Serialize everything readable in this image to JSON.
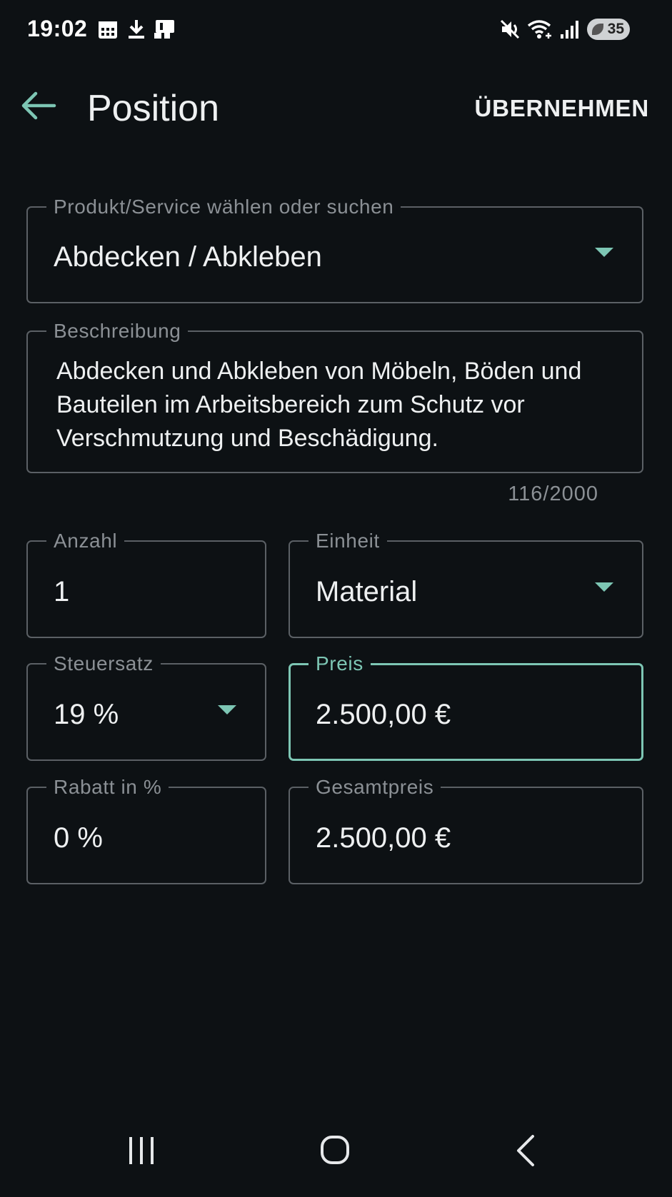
{
  "status_bar": {
    "time": "19:02",
    "battery_level": "35",
    "icons": [
      "calendar-icon",
      "download-icon",
      "clipboard-icon",
      "mute-icon",
      "wifi-icon",
      "signal-icon",
      "battery-icon"
    ]
  },
  "app_bar": {
    "title": "Position",
    "action_label": "ÜBERNEHMEN",
    "back_icon": "arrow-left-icon"
  },
  "form": {
    "product": {
      "label": "Produkt/Service wählen oder suchen",
      "value": "Abdecken / Abkleben"
    },
    "description": {
      "label": "Beschreibung",
      "value": "Abdecken und Abkleben von Möbeln, Böden und Bauteilen im Arbeitsbereich zum Schutz vor Verschmutzung und Beschädigung.",
      "counter": "116/2000"
    },
    "quantity": {
      "label": "Anzahl",
      "value": "1"
    },
    "unit": {
      "label": "Einheit",
      "value": "Material"
    },
    "tax_rate": {
      "label": "Steuersatz",
      "value": "19 %"
    },
    "price": {
      "label": "Preis",
      "value": "2.500,00 €"
    },
    "discount": {
      "label": "Rabatt in %",
      "value": "0 %"
    },
    "total_price": {
      "label": "Gesamtpreis",
      "value": "2.500,00 €"
    }
  },
  "nav_bar": {
    "items": [
      "recent-apps-icon",
      "home-icon",
      "back-icon"
    ]
  },
  "colors": {
    "background": "#0d1114",
    "accent": "#7dc6b4",
    "outline": "#5b6065",
    "label": "#8b9095",
    "text": "#eef0f1"
  }
}
